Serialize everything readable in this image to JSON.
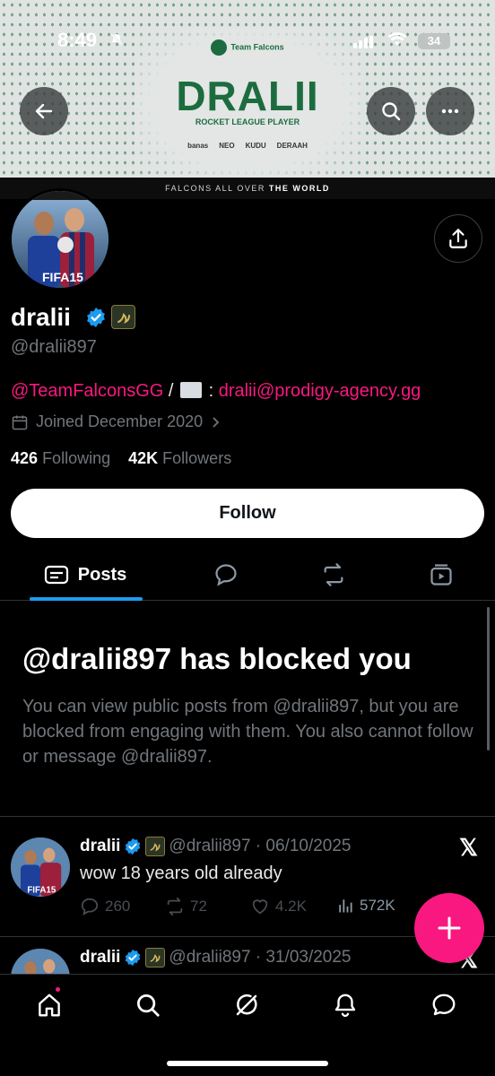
{
  "status_bar": {
    "time": "8:49",
    "battery": "34"
  },
  "banner": {
    "team": "Team Falcons",
    "player": "DRALII",
    "role": "ROCKET LEAGUE PLAYER",
    "sponsors": [
      "banas",
      "NEO",
      "KUDU",
      "DERAAH"
    ],
    "strip_prefix": "FALCONS ALL OVER ",
    "strip_bold": "THE WORLD"
  },
  "profile": {
    "display_name": "dralii",
    "handle": "@dralii897",
    "bio_link": "@TeamFalconsGG",
    "bio_sep": " / ",
    "bio_colon": " : ",
    "bio_email": "dralii@prodigy-agency.gg",
    "joined": "Joined December 2020",
    "following_count": "426",
    "following_label": "Following",
    "followers_count": "42K",
    "followers_label": "Followers",
    "follow_label": "Follow"
  },
  "tabs": {
    "posts": "Posts"
  },
  "blocked": {
    "title": "@dralii897 has blocked you",
    "text": "You can view public posts from @dralii897, but you are blocked from engaging with them. You also cannot follow or message @dralii897."
  },
  "posts": [
    {
      "name": "dralii",
      "handle_date": "@dralii897 · 06/10/2025",
      "text": "wow 18 years old already",
      "replies": "260",
      "reposts": "72",
      "likes": "4.2K",
      "views": "572K"
    },
    {
      "name": "dralii",
      "handle_date": "@dralii897 · 31/03/2025"
    }
  ],
  "colors": {
    "accent": "#1d9bf0",
    "link": "#f91880",
    "background": "#000000"
  }
}
